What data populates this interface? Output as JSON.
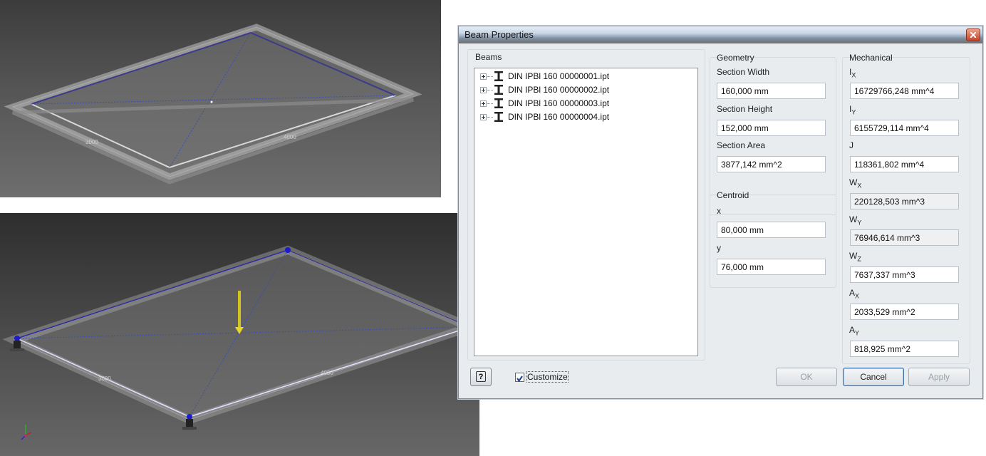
{
  "viewport_top": {
    "dim_a": "3000",
    "dim_b": "4000"
  },
  "viewport_bottom": {
    "dim_a": "3000",
    "dim_b": "4000"
  },
  "dialog": {
    "title": "Beam Properties",
    "beams": {
      "label": "Beams",
      "items": [
        "DIN IPBl 160 00000001.ipt",
        "DIN IPBl 160 00000002.ipt",
        "DIN IPBl 160 00000003.ipt",
        "DIN IPBl 160 00000004.ipt"
      ]
    },
    "geometry": {
      "label": "Geometry",
      "section_width_label": "Section Width",
      "section_width": "160,000 mm",
      "section_height_label": "Section Height",
      "section_height": "152,000 mm",
      "section_area_label": "Section Area",
      "section_area": "3877,142 mm^2"
    },
    "centroid": {
      "label": "Centroid",
      "x_label": "x",
      "x": "80,000 mm",
      "y_label": "y",
      "y": "76,000 mm"
    },
    "mechanical": {
      "label": "Mechanical",
      "ix_label": "I",
      "ix_sub": "X",
      "ix": "16729766,248 mm^4",
      "iy_label": "I",
      "iy_sub": "Y",
      "iy": "6155729,114 mm^4",
      "j_label": "J",
      "j": "118361,802 mm^4",
      "wx_label": "W",
      "wx_sub": "X",
      "wx": "220128,503 mm^3",
      "wy_label": "W",
      "wy_sub": "Y",
      "wy": "76946,614 mm^3",
      "wz_label": "W",
      "wz_sub": "Z",
      "wz": "7637,337 mm^3",
      "ax_label": "A",
      "ax_sub": "X",
      "ax": "2033,529 mm^2",
      "ay_label": "A",
      "ay_sub": "Y",
      "ay": "818,925 mm^2"
    },
    "customize_label": "Customize",
    "customize_checked": true,
    "buttons": {
      "ok": "OK",
      "cancel": "Cancel",
      "apply": "Apply"
    }
  }
}
